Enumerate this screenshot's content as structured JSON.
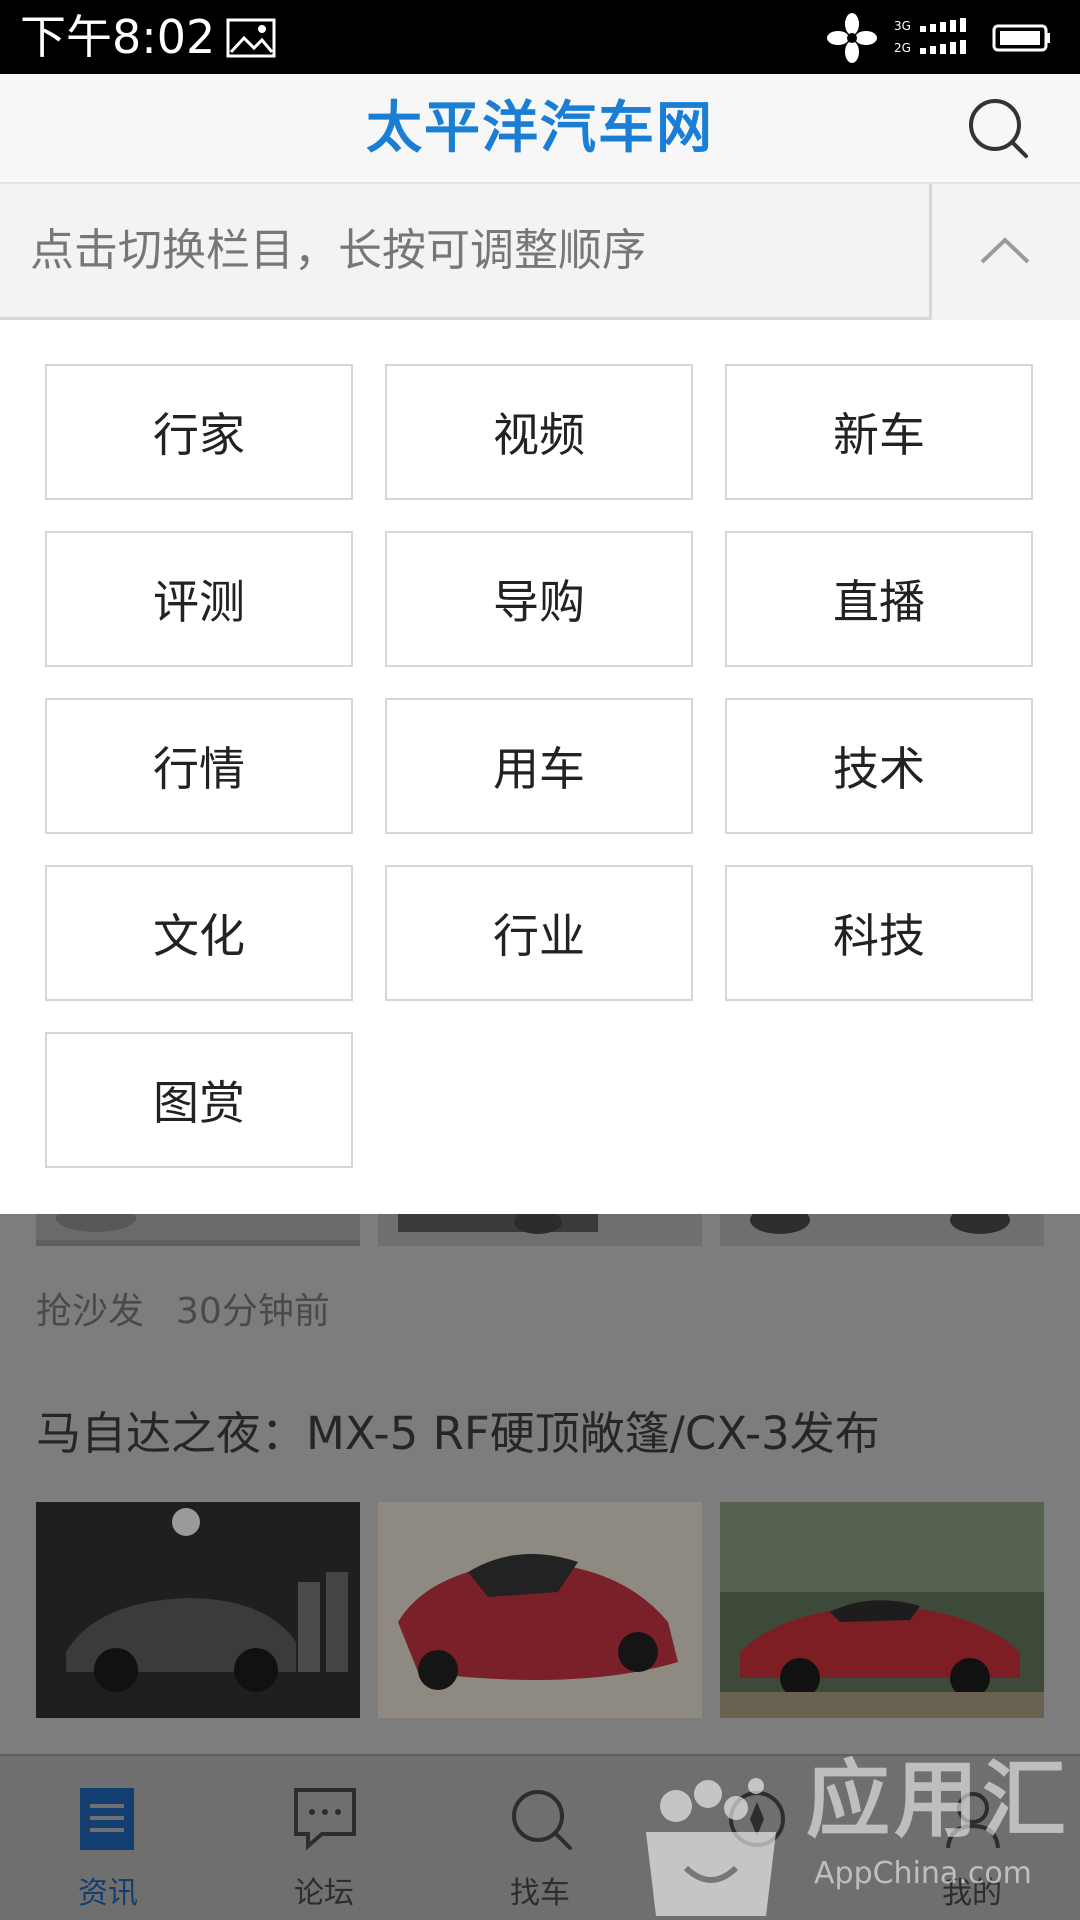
{
  "status_bar": {
    "time": "下午8:02",
    "network_top": "3G",
    "network_bottom": "2G",
    "icons": [
      "image-icon",
      "flower-icon",
      "signal-icon",
      "battery-icon"
    ]
  },
  "header": {
    "logo": "太平洋汽车网",
    "logo_color": "#1a7fd4",
    "search_icon": "search-icon"
  },
  "channel_editor": {
    "hint": "点击切换栏目，长按可调整顺序",
    "collapse_icon": "chevron-up-icon",
    "categories": [
      "行家",
      "视频",
      "新车",
      "评测",
      "导购",
      "直播",
      "行情",
      "用车",
      "技术",
      "文化",
      "行业",
      "科技",
      "图赏"
    ]
  },
  "feed": {
    "prev_item_meta": {
      "comment": "抢沙发",
      "age": "30分钟前"
    },
    "article_title": "马自达之夜：MX-5 RF硬顶敞篷/CX-3发布"
  },
  "bottom_nav": {
    "items": [
      {
        "label": "资讯",
        "icon": "news-icon",
        "active": true
      },
      {
        "label": "论坛",
        "icon": "forum-icon",
        "active": false
      },
      {
        "label": "找车",
        "icon": "find-car-icon",
        "active": false
      },
      {
        "label": "",
        "icon": "discover-icon",
        "active": false
      },
      {
        "label": "我的",
        "icon": "profile-icon",
        "active": false
      }
    ],
    "active_color": "#1a5fa8"
  },
  "watermark": {
    "text": "应用汇",
    "sub": "AppChina.com"
  }
}
